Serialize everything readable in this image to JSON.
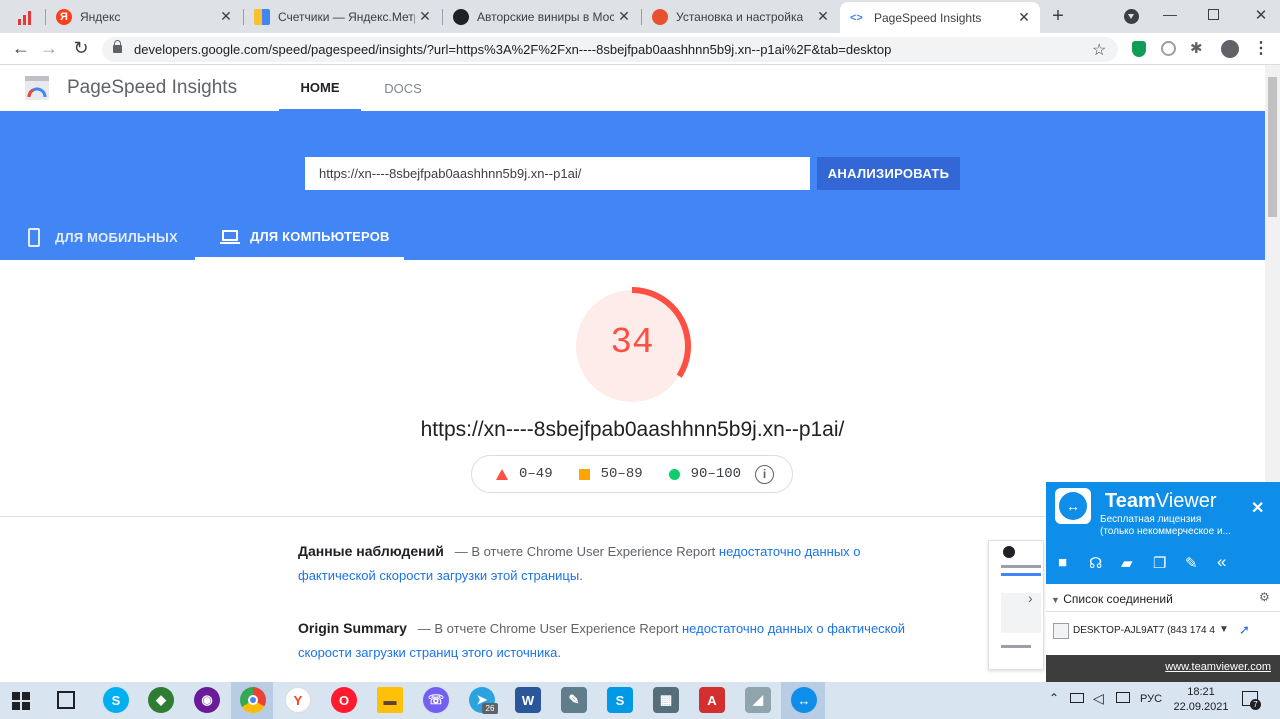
{
  "browser": {
    "tabs": [
      {
        "label": "",
        "favicon_color": "#e53935"
      },
      {
        "label": "Яндекс",
        "favicon_color": "#fc3f1d"
      },
      {
        "label": "Счетчики — Яндекс.Метрика",
        "favicon_color": "#fbc02d"
      },
      {
        "label": "Авторские виниры в Москве",
        "favicon_color": "#202124"
      },
      {
        "label": "Установка и настройка",
        "favicon_color": "#e8502f"
      },
      {
        "label": "PageSpeed Insights",
        "favicon_color": "#4285f4"
      }
    ],
    "url": "developers.google.com/speed/pagespeed/insights/?url=https%3A%2F%2Fxn----8sbejfpab0aashhnn5b9j.xn--p1ai%2F&tab=desktop"
  },
  "psi": {
    "brand": "PageSpeed Insights",
    "nav": {
      "home": "HOME",
      "docs": "DOCS"
    },
    "search": {
      "value": "https://xn----8sbejfpab0aashhnn5b9j.xn--p1ai/",
      "button": "АНАЛИЗИРОВАТЬ"
    },
    "device_tabs": {
      "mobile": "ДЛЯ МОБИЛЬНЫХ",
      "desktop": "ДЛЯ КОМПЬЮТЕРОВ"
    },
    "score": {
      "value": "34",
      "fraction": 0.34,
      "color": "#ff4e42"
    },
    "analyzed_url": "https://xn----8sbejfpab0aashhnn5b9j.xn--p1ai/",
    "legend": {
      "bad": "0–49",
      "average": "50–89",
      "good": "90–100"
    },
    "field_data": {
      "title": "Данные наблюдений",
      "dash": "— В отчете Chrome User Experience Report",
      "link": "недостаточно данных о фактической скорости загрузки этой страницы",
      "end": "."
    },
    "origin_summary": {
      "title": "Origin Summary",
      "dash": "— В отчете Chrome User Experience Report",
      "link": "недостаточно данных о фактической скорости загрузки страниц этого источника",
      "end": "."
    }
  },
  "teamviewer": {
    "name_bold": "Team",
    "name_rest": "Viewer",
    "license_line1": "Бесплатная лицензия",
    "license_line2": "(только некоммерческое и...",
    "list_title": "Список соединений",
    "device": "DESKTOP-AJL9AT7 (843 174 4",
    "footer_link": "www.teamviewer.com"
  },
  "taskbar": {
    "time": "18:21",
    "date": "22.09.2021",
    "lang": "РУС",
    "notifications": "7",
    "telegram_badge": "26"
  }
}
